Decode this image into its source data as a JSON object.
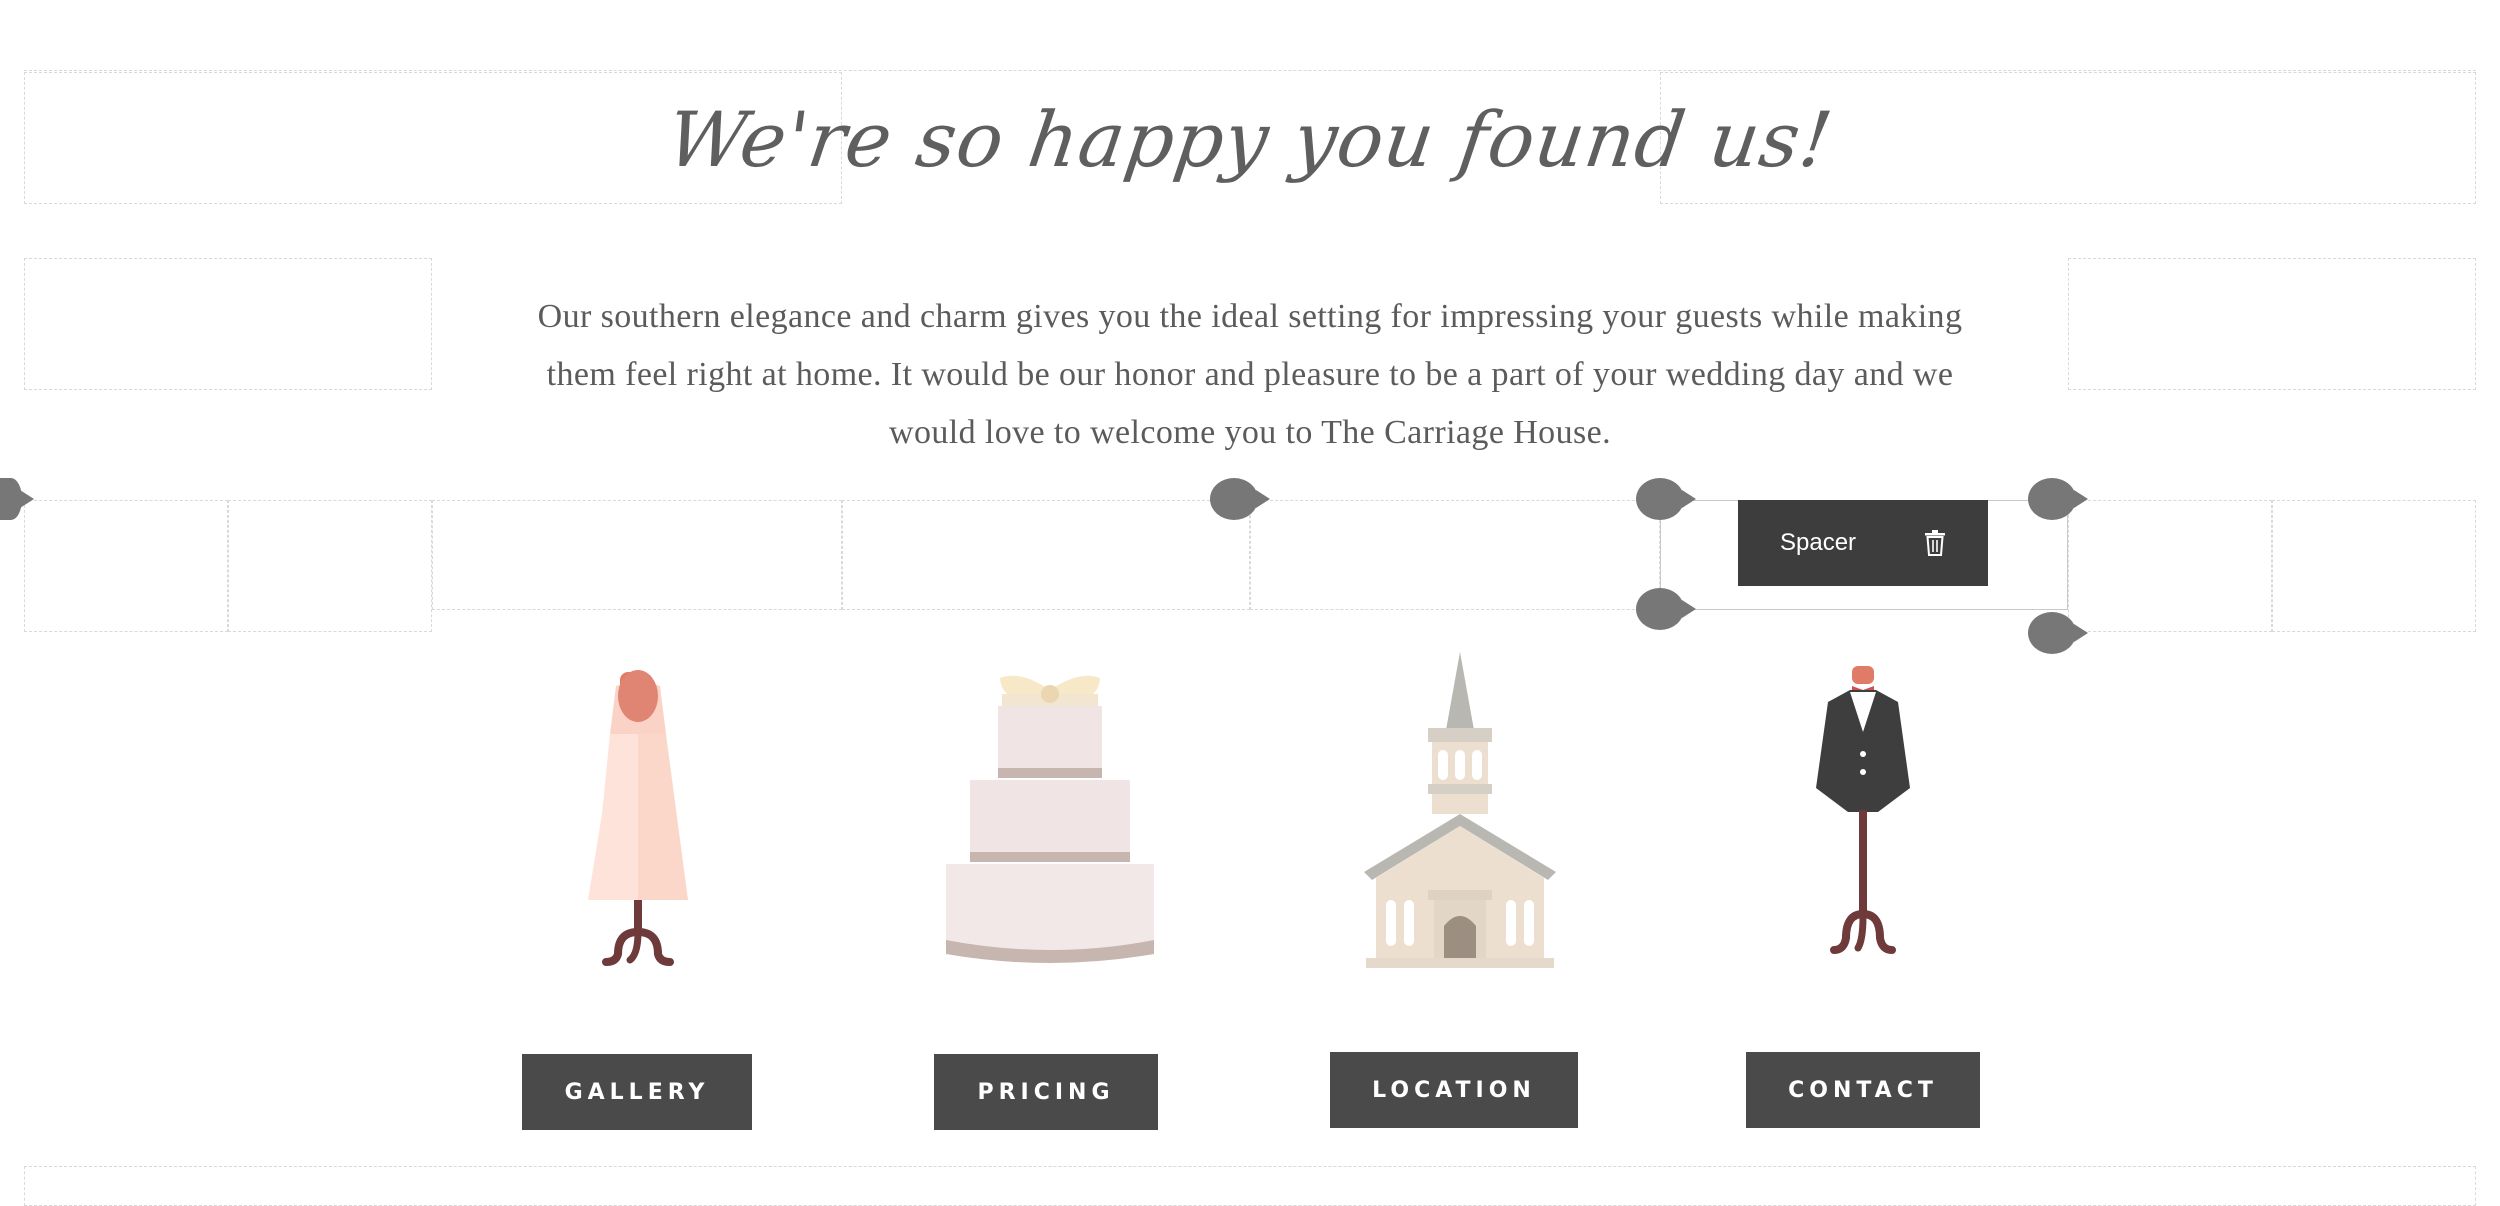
{
  "header": {
    "heading": "We're so happy you found us!"
  },
  "intro": {
    "lines": [
      "Our southern elegance and charm gives you the ideal setting for impressing your guests while making",
      "them feel right at home. It would be our honor and pleasure to be a part of your wedding day and we",
      "would love to welcome you to The Carriage House."
    ]
  },
  "editor": {
    "spacer_label": "Spacer",
    "delete_icon": "trash-icon"
  },
  "illustrations": [
    "dress-icon",
    "cake-icon",
    "chapel-icon",
    "tuxedo-icon"
  ],
  "nav_buttons": [
    {
      "label": "GALLERY"
    },
    {
      "label": "PRICING"
    },
    {
      "label": "LOCATION"
    },
    {
      "label": "CONTACT"
    }
  ],
  "colors": {
    "button_bg": "#4a4a4a",
    "toolbar_bg": "#3d3d3d",
    "handle": "#777777",
    "text": "#5a5a5a"
  }
}
